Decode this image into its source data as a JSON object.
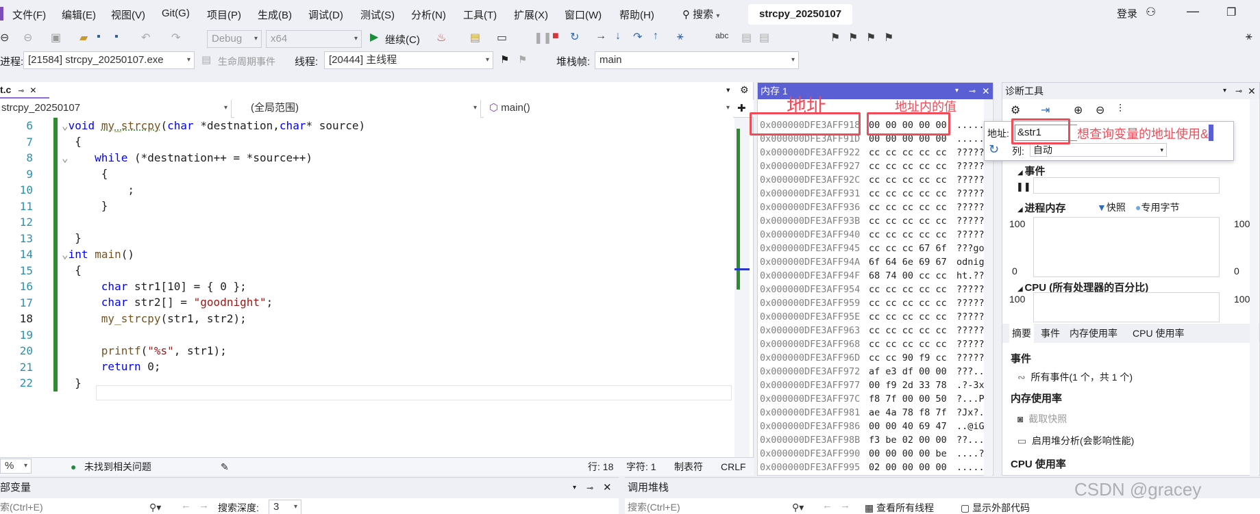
{
  "menu": [
    "文件(F)",
    "编辑(E)",
    "视图(V)",
    "Git(G)",
    "项目(P)",
    "生成(B)",
    "调试(D)",
    "测试(S)",
    "分析(N)",
    "工具(T)",
    "扩展(X)",
    "窗口(W)",
    "帮助(H)"
  ],
  "search_label": "搜索",
  "solution_tab": "strcpy_20250107",
  "login": "登录",
  "toolbar": {
    "config": "Debug",
    "platform": "x64",
    "continue": "继续(C)"
  },
  "debugbar": {
    "process_label": "进程:",
    "process": "[21584] strcpy_20250107.exe",
    "lifecycle": "生命周期事件",
    "thread_label": "线程:",
    "thread": "[20444] 主线程",
    "stack_label": "堆栈帧:",
    "stack": "main"
  },
  "editor": {
    "tab": "t.c",
    "nav_project": "strcpy_20250107",
    "nav_scope": "(全局范围)",
    "nav_func": "main()",
    "line_numbers": [
      "6",
      "7",
      "8",
      "9",
      "10",
      "11",
      "12",
      "13",
      "14",
      "15",
      "16",
      "17",
      "18",
      "19",
      "20",
      "21",
      "22"
    ],
    "status": {
      "zoom": "%",
      "issues": "未找到相关问题",
      "row": "行: 18",
      "col": "字符: 1",
      "tabs": "制表符",
      "eol": "CRLF"
    }
  },
  "memory": {
    "title": "内存 1",
    "rows": [
      {
        "addr": "0x000000DFE3AFF918",
        "bytes": "00 00 00 00 00",
        "chars": "....."
      },
      {
        "addr": "0x000000DFE3AFF91D",
        "bytes": "00 00 00 00 00",
        "chars": "....."
      },
      {
        "addr": "0x000000DFE3AFF922",
        "bytes": "cc cc cc cc cc",
        "chars": "?????"
      },
      {
        "addr": "0x000000DFE3AFF927",
        "bytes": "cc cc cc cc cc",
        "chars": "?????"
      },
      {
        "addr": "0x000000DFE3AFF92C",
        "bytes": "cc cc cc cc cc",
        "chars": "?????"
      },
      {
        "addr": "0x000000DFE3AFF931",
        "bytes": "cc cc cc cc cc",
        "chars": "?????"
      },
      {
        "addr": "0x000000DFE3AFF936",
        "bytes": "cc cc cc cc cc",
        "chars": "?????"
      },
      {
        "addr": "0x000000DFE3AFF93B",
        "bytes": "cc cc cc cc cc",
        "chars": "?????"
      },
      {
        "addr": "0x000000DFE3AFF940",
        "bytes": "cc cc cc cc cc",
        "chars": "?????"
      },
      {
        "addr": "0x000000DFE3AFF945",
        "bytes": "cc cc cc 67 6f",
        "chars": "???go"
      },
      {
        "addr": "0x000000DFE3AFF94A",
        "bytes": "6f 64 6e 69 67",
        "chars": "odnig"
      },
      {
        "addr": "0x000000DFE3AFF94F",
        "bytes": "68 74 00 cc cc",
        "chars": "ht.??"
      },
      {
        "addr": "0x000000DFE3AFF954",
        "bytes": "cc cc cc cc cc",
        "chars": "?????"
      },
      {
        "addr": "0x000000DFE3AFF959",
        "bytes": "cc cc cc cc cc",
        "chars": "?????"
      },
      {
        "addr": "0x000000DFE3AFF95E",
        "bytes": "cc cc cc cc cc",
        "chars": "?????"
      },
      {
        "addr": "0x000000DFE3AFF963",
        "bytes": "cc cc cc cc cc",
        "chars": "?????"
      },
      {
        "addr": "0x000000DFE3AFF968",
        "bytes": "cc cc cc cc cc",
        "chars": "?????"
      },
      {
        "addr": "0x000000DFE3AFF96D",
        "bytes": "cc cc 90 f9 cc",
        "chars": "?????"
      },
      {
        "addr": "0x000000DFE3AFF972",
        "bytes": "af e3 df 00 00",
        "chars": "???.."
      },
      {
        "addr": "0x000000DFE3AFF977",
        "bytes": "00 f9 2d 33 78",
        "chars": ".?-3x"
      },
      {
        "addr": "0x000000DFE3AFF97C",
        "bytes": "f8 7f 00 00 50",
        "chars": "?...P"
      },
      {
        "addr": "0x000000DFE3AFF981",
        "bytes": "ae 4a 78 f8 7f",
        "chars": "?Jx?."
      },
      {
        "addr": "0x000000DFE3AFF986",
        "bytes": "00 00 40 69 47",
        "chars": "..@iG"
      },
      {
        "addr": "0x000000DFE3AFF98B",
        "bytes": "f3 be 02 00 00",
        "chars": "??..."
      },
      {
        "addr": "0x000000DFE3AFF990",
        "bytes": "00 00 00 00 be",
        "chars": "....?"
      },
      {
        "addr": "0x000000DFE3AFF995",
        "bytes": "02 00 00 00 00",
        "chars": "....."
      }
    ]
  },
  "annotations": {
    "addr": "地址",
    "value": "地址内的值",
    "hint": "想查询变量的地址使用&"
  },
  "diag": {
    "title": "诊断工具",
    "addr_label": "地址:",
    "addr_value": "&str1",
    "col_label": "列:",
    "col_value": "自动",
    "events": "事件",
    "proc_mem": "进程内存",
    "snapshot": "快照",
    "private_bytes": "专用字节",
    "y_top": "100",
    "y_bottom": "0",
    "cpu_title": "CPU (所有处理器的百分比)",
    "tabs": [
      "摘要",
      "事件",
      "内存使用率",
      "CPU 使用率"
    ],
    "sum_events": "事件",
    "all_events": "所有事件(1 个，共 1 个)",
    "mem_usage": "内存使用率",
    "take_snapshot": "截取快照",
    "heap_profile": "启用堆分析(会影响性能)",
    "cpu_usage": "CPU 使用率"
  },
  "bottom": {
    "locals": "部变量",
    "locals_search": "索(Ctrl+E)",
    "depth_label": "搜索深度:",
    "depth": "3",
    "callstack": "调用堆栈",
    "cs_search": "搜索(Ctrl+E)",
    "all_threads": "查看所有线程",
    "external": "显示外部代码"
  },
  "watermark": "CSDN @gracey"
}
